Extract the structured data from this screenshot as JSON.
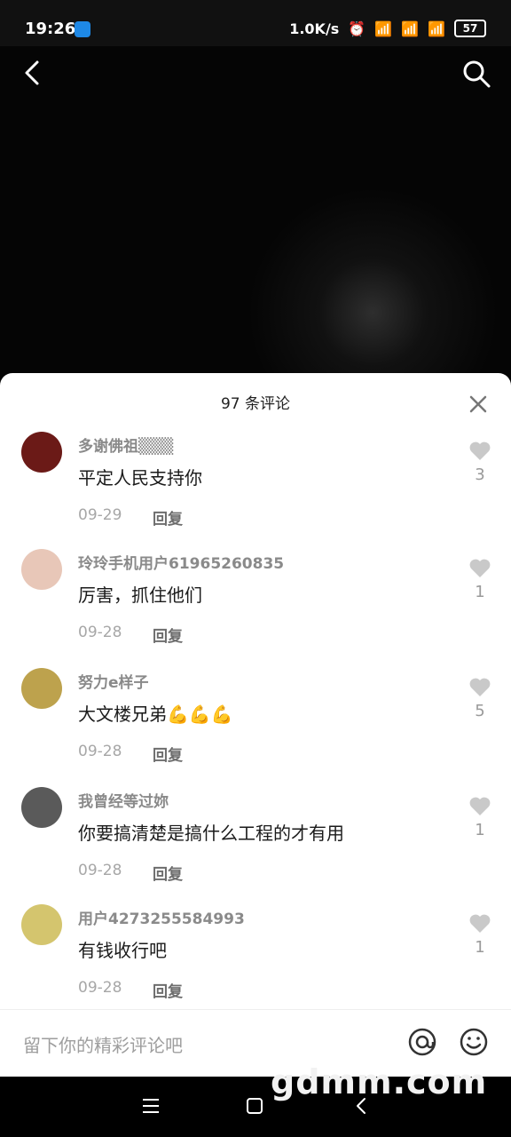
{
  "status": {
    "time": "19:26",
    "net_speed": "1.0K/s",
    "signal_1": "HD",
    "signal_2": "HD",
    "battery": "57"
  },
  "header": {
    "back_icon": "back-arrow-icon",
    "search_icon": "search-icon"
  },
  "comments_panel": {
    "title": "97 条评论",
    "close_icon": "close-icon",
    "comments": [
      {
        "user": "多谢佛祖▒▒▒",
        "text": "平定人民支持你",
        "date": "09-29",
        "reply": "回复",
        "likes": "3",
        "avatar_color": "#6b1a17"
      },
      {
        "user": "玲玲手机用户61965260835",
        "text": "厉害，抓住他们",
        "date": "09-28",
        "reply": "回复",
        "likes": "1",
        "avatar_color": "#e8c7b8"
      },
      {
        "user": "努力e样子",
        "text": "大文楼兄弟💪💪💪",
        "date": "09-28",
        "reply": "回复",
        "likes": "5",
        "avatar_color": "#bda24d"
      },
      {
        "user": "我曾经等过妳",
        "text": "你要搞清楚是搞什么工程的才有用",
        "date": "09-28",
        "reply": "回复",
        "likes": "1",
        "avatar_color": "#5a5a5a"
      },
      {
        "user": "用户4273255584993",
        "text": "有钱收行吧",
        "date": "09-28",
        "reply": "回复",
        "likes": "1",
        "avatar_color": "#d4c56e"
      }
    ]
  },
  "input": {
    "placeholder": "留下你的精彩评论吧",
    "at_icon": "at-icon",
    "emoji_icon": "emoji-icon"
  },
  "watermark": "gdmm.com"
}
